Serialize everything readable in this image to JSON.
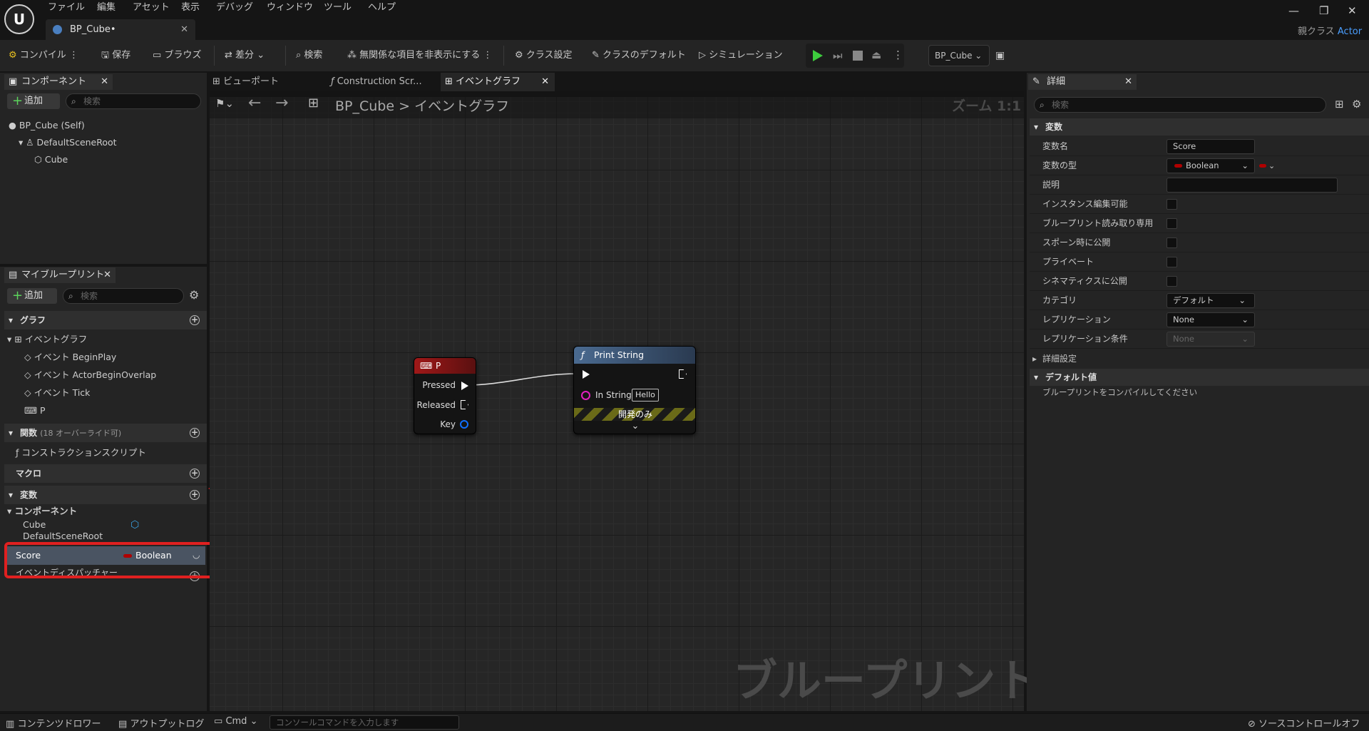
{
  "app": {
    "logo": "U",
    "doc_tab": "BP_Cube•",
    "parent_class_label": "親クラス",
    "parent_class_value": "Actor"
  },
  "menu": [
    "ファイル",
    "編集",
    "アセット",
    "表示",
    "デバッグ",
    "ウィンドウ",
    "ツール",
    "ヘルプ"
  ],
  "toolbar": {
    "compile": "コンパイル",
    "save": "保存",
    "browse": "ブラウズ",
    "diff": "差分",
    "find": "検索",
    "hide_unrelated": "無関係な項目を非表示にする",
    "class_settings": "クラス設定",
    "class_defaults": "クラスのデフォルト",
    "simulation": "シミュレーション",
    "debug_object": "BP_Cube"
  },
  "components": {
    "tab": "コンポーネント",
    "add": "追加",
    "search_placeholder": "検索",
    "items": [
      "BP_Cube (Self)",
      "DefaultSceneRoot",
      "Cube"
    ]
  },
  "mybp": {
    "tab": "マイブループリント",
    "add": "追加",
    "search_placeholder": "検索",
    "graphs_header": "グラフ",
    "event_graph": "イベントグラフ",
    "events": [
      "イベント BeginPlay",
      "イベント ActorBeginOverlap",
      "イベント Tick",
      "P"
    ],
    "functions_header": "関数",
    "functions_sub": "(18 オーバーライド可)",
    "construction": "コンストラクションスクリプト",
    "macros_header": "マクロ",
    "variables_header": "変数",
    "comp_group": "コンポーネント",
    "var_cube": "Cube",
    "var_root": "DefaultSceneRoot",
    "var_score": "Score",
    "var_score_type": "Boolean",
    "dispatchers": "イベントディスパッチャー"
  },
  "graph_tabs": [
    "ビューポート",
    "Construction Scr...",
    "イベントグラフ"
  ],
  "graph": {
    "breadcrumb_bp": "BP_Cube",
    "breadcrumb_sep": ">",
    "breadcrumb_graph": "イベントグラフ",
    "zoom": "ズーム 1:1",
    "watermark": "ブループリント",
    "key_node": {
      "title": "P",
      "pins": [
        "Pressed",
        "Released",
        "Key"
      ]
    },
    "print_node": {
      "title": "Print String",
      "in_string_label": "In String",
      "in_string_value": "Hello",
      "dev_only": "開発のみ"
    }
  },
  "details": {
    "tab": "詳細",
    "search_placeholder": "検索",
    "section_variable": "変数",
    "rows": [
      {
        "label": "変数名",
        "value": "Score"
      },
      {
        "label": "変数の型",
        "value": "Boolean"
      },
      {
        "label": "説明",
        "value": ""
      },
      {
        "label": "インスタンス編集可能"
      },
      {
        "label": "ブループリント読み取り専用"
      },
      {
        "label": "スポーン時に公開"
      },
      {
        "label": "プライベート"
      },
      {
        "label": "シネマティクスに公開"
      },
      {
        "label": "カテゴリ",
        "value": "デフォルト"
      },
      {
        "label": "レプリケーション",
        "value": "None"
      },
      {
        "label": "レプリケーション条件",
        "value": "None"
      }
    ],
    "advanced": "詳細設定",
    "section_default": "デフォルト値",
    "compile_msg": "ブループリントをコンパイルしてください"
  },
  "statusbar": {
    "content_drawer": "コンテンツドロワー",
    "output_log": "アウトプットログ",
    "cmd": "Cmd",
    "console_placeholder": "コンソールコマンドを入力します",
    "source_control": "ソースコントロールオフ"
  },
  "colors": {
    "accent_blue": "#4a9eff",
    "highlight_red": "#e02020",
    "bool_red": "#a00000",
    "play_green": "#3dcc3d"
  }
}
